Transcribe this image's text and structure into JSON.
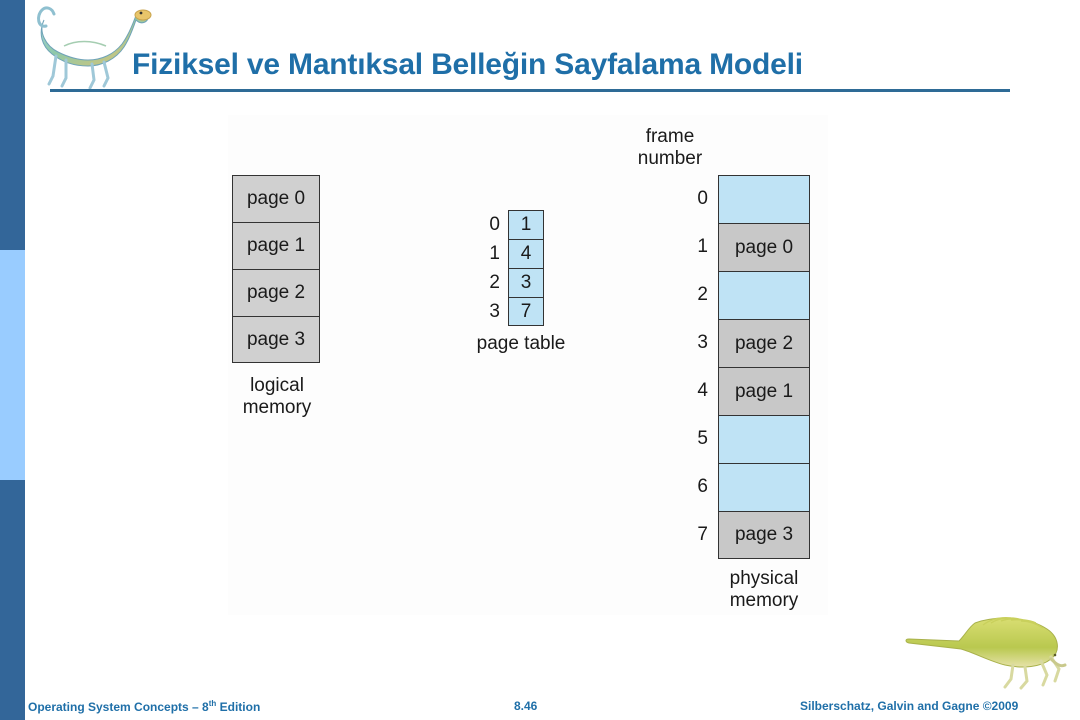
{
  "slide": {
    "title": "Fiziksel ve Mantıksal Belleğin Sayfalama Modeli",
    "accent_color": "#1F6FA8",
    "bar_dark_color": "#336699",
    "bar_light_color": "#99CCFF"
  },
  "decor": {
    "top_dinosaur": "dinosaur-illustration",
    "bottom_dinosaur": "dimetrodon-illustration"
  },
  "figure": {
    "logical_memory": {
      "caption": "logical\nmemory",
      "caption_line1": "logical",
      "caption_line2": "memory",
      "cell_color": "#D0D0D0",
      "cells": [
        "page 0",
        "page 1",
        "page 2",
        "page 3"
      ]
    },
    "page_table": {
      "caption": "page table",
      "cell_color": "#BFE3F5",
      "indices": [
        "0",
        "1",
        "2",
        "3"
      ],
      "values": [
        "1",
        "4",
        "3",
        "7"
      ]
    },
    "physical_memory": {
      "header_line1": "frame",
      "header_line2": "number",
      "caption_line1": "physical",
      "caption_line2": "memory",
      "free_color": "#BFE3F5",
      "filled_color": "#C8C8C8",
      "frames": [
        {
          "index": "0",
          "content": "",
          "state": "free"
        },
        {
          "index": "1",
          "content": "page 0",
          "state": "filled"
        },
        {
          "index": "2",
          "content": "",
          "state": "free"
        },
        {
          "index": "3",
          "content": "page 2",
          "state": "filled"
        },
        {
          "index": "4",
          "content": "page 1",
          "state": "filled"
        },
        {
          "index": "5",
          "content": "",
          "state": "free"
        },
        {
          "index": "6",
          "content": "",
          "state": "free"
        },
        {
          "index": "7",
          "content": "page 3",
          "state": "filled"
        }
      ]
    }
  },
  "footer": {
    "left_pre": "Operating System Concepts – 8",
    "left_sup": "th",
    "left_post": " Edition",
    "page_number": "8.46",
    "right": "Silberschatz, Galvin and Gagne ©2009"
  }
}
